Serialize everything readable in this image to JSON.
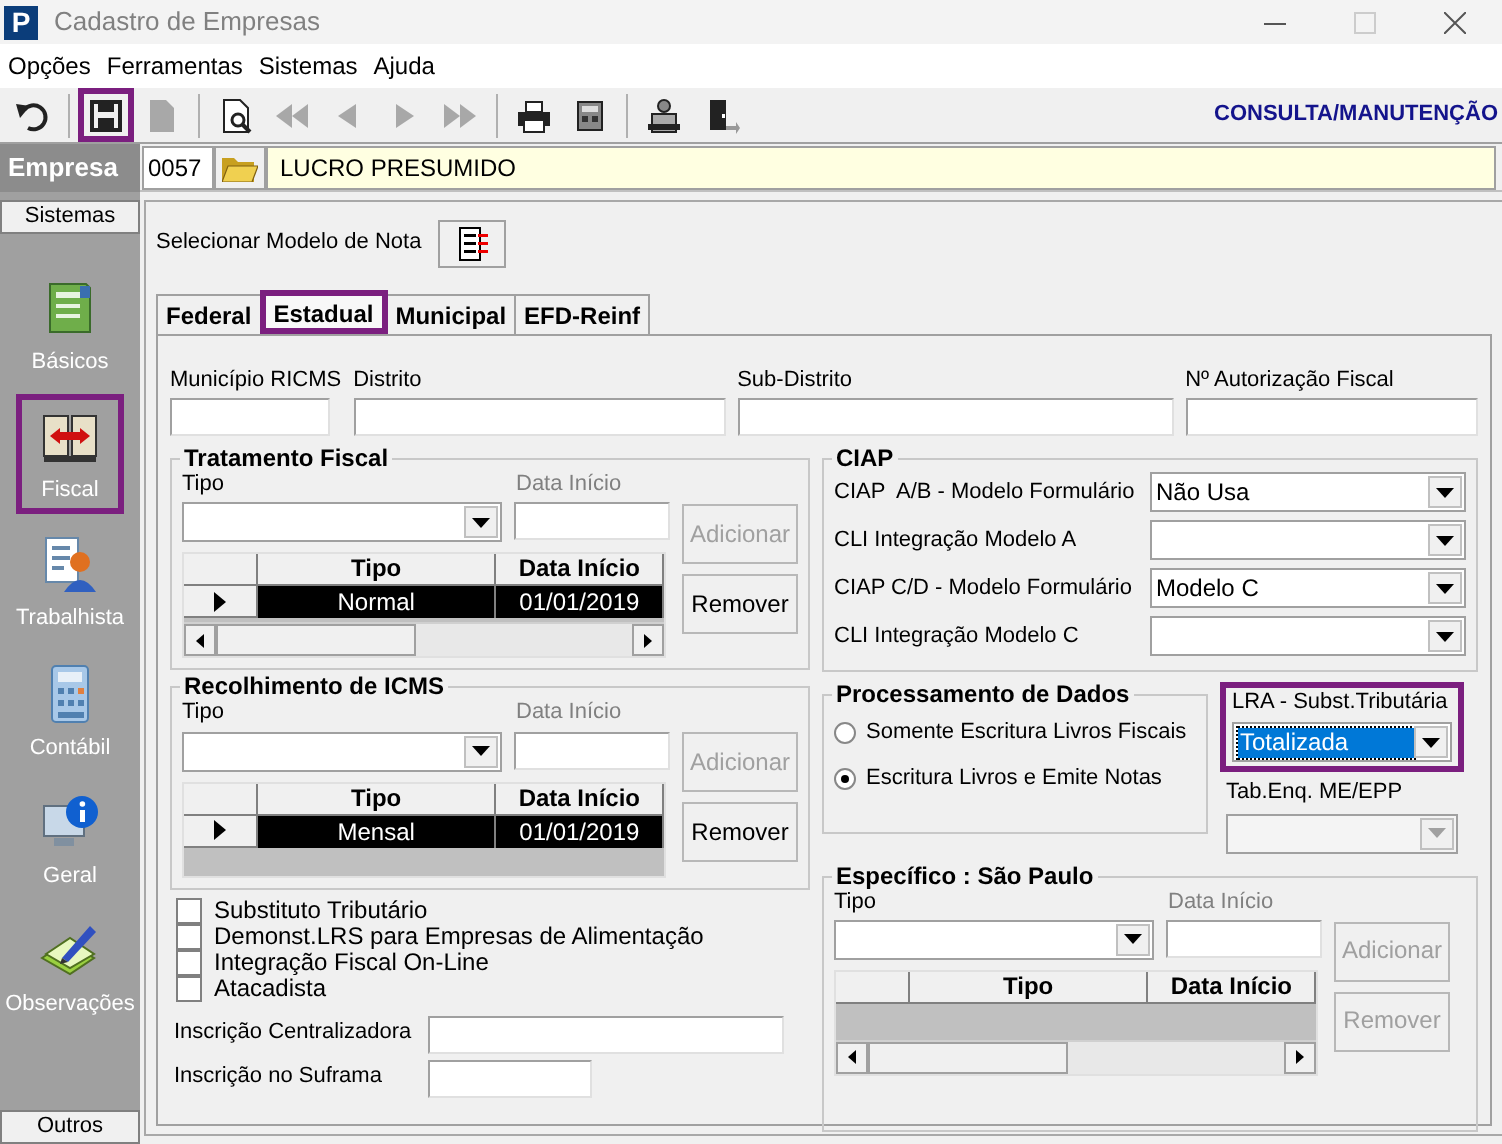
{
  "window": {
    "title": "Cadastro de Empresas",
    "app_letter": "P"
  },
  "menu": [
    "Opções",
    "Ferramentas",
    "Sistemas",
    "Ajuda"
  ],
  "toolbar": {
    "buttons": [
      {
        "disabled": false,
        "highlighted": false
      },
      {
        "disabled": false,
        "highlighted": true
      },
      {
        "disabled": true,
        "highlighted": false
      },
      {
        "disabled": false,
        "highlighted": false
      },
      {
        "disabled": true,
        "highlighted": false
      },
      {
        "disabled": true,
        "highlighted": false
      },
      {
        "disabled": true,
        "highlighted": false
      },
      {
        "disabled": true,
        "highlighted": false
      },
      {
        "disabled": false,
        "highlighted": false
      },
      {
        "disabled": false,
        "highlighted": false
      },
      {
        "disabled": false,
        "highlighted": false
      },
      {
        "disabled": false,
        "highlighted": false
      }
    ],
    "mode": "CONSULTA/MANUTENÇÃO"
  },
  "empresa": {
    "label": "Empresa",
    "code": "0057",
    "name": "LUCRO PRESUMIDO"
  },
  "sidebar": {
    "header": "Sistemas",
    "items": [
      {
        "label": "Básicos",
        "highlighted": false
      },
      {
        "label": "Fiscal",
        "highlighted": true
      },
      {
        "label": "Trabalhista",
        "highlighted": false
      },
      {
        "label": "Contábil",
        "highlighted": false
      },
      {
        "label": "Geral",
        "highlighted": false
      },
      {
        "label": "Observações",
        "highlighted": false
      }
    ],
    "footer": "Outros"
  },
  "modelo_nota": {
    "label": "Selecionar Modelo de Nota"
  },
  "tabs": [
    {
      "label": "Federal",
      "selected": false,
      "highlighted": false
    },
    {
      "label": "Estadual",
      "selected": true,
      "highlighted": true
    },
    {
      "label": "Municipal",
      "selected": false,
      "highlighted": false
    },
    {
      "label": "EFD-Reinf",
      "selected": false,
      "highlighted": false
    }
  ],
  "top_fields": [
    {
      "label": "Município RICMS"
    },
    {
      "label": "Distrito"
    },
    {
      "label": "Sub-Distrito"
    },
    {
      "label": "Nº Autorização Fiscal"
    }
  ],
  "tratamento_fiscal": {
    "title": "Tratamento Fiscal",
    "tipo_label": "Tipo",
    "date": {
      "label": "Data Início",
      "disabled": true
    },
    "grid": {
      "columns": [
        "Tipo",
        "Data Início"
      ],
      "horizontal_scroll": true,
      "rows": [
        {
          "tipo": "Normal",
          "data": "01/01/2019",
          "selected": true
        }
      ]
    },
    "buttons": [
      {
        "label": "Adicionar",
        "disabled": true
      },
      {
        "label": "Remover",
        "disabled": false
      }
    ]
  },
  "recolhimento_icms": {
    "title": "Recolhimento de ICMS",
    "tipo_label": "Tipo",
    "date": {
      "label": "Data Início",
      "disabled": true
    },
    "grid": {
      "columns": [
        "Tipo",
        "Data Início"
      ],
      "horizontal_scroll": false,
      "rows": [
        {
          "tipo": "Mensal",
          "data": "01/01/2019",
          "selected": true
        }
      ]
    },
    "buttons": [
      {
        "label": "Adicionar",
        "disabled": true
      },
      {
        "label": "Remover",
        "disabled": false
      }
    ]
  },
  "checkboxes": [
    {
      "label": "Substituto Tributário",
      "checked": false
    },
    {
      "label": "Demonst.LRS para Empresas de Alimentação",
      "checked": false
    },
    {
      "label": "Integração Fiscal On-Line",
      "checked": false
    },
    {
      "label": "Atacadista",
      "checked": false
    }
  ],
  "inscricoes": [
    {
      "label": "Inscrição Centralizadora"
    },
    {
      "label": "Inscrição no Suframa"
    }
  ],
  "ciap": {
    "title": "CIAP",
    "rows": [
      {
        "label": "CIAP  A/B - Modelo Formulário",
        "value": "Não Usa"
      },
      {
        "label": "CLI Integração Modelo A"
      },
      {
        "label": "CIAP C/D - Modelo Formulário",
        "value": "Modelo C"
      },
      {
        "label": "CLI Integração Modelo C"
      }
    ]
  },
  "processamento": {
    "title": "Processamento de Dados",
    "options": [
      {
        "label": "Somente Escritura Livros Fiscais",
        "selected": false
      },
      {
        "label": "Escritura Livros e Emite Notas",
        "selected": true
      }
    ]
  },
  "lra": {
    "label": "LRA - Subst.Tributária",
    "value": "Totalizada",
    "focused": true,
    "highlighted": true
  },
  "tab_enq": {
    "label": "Tab.Enq. ME/EPP",
    "disabled": true
  },
  "especifico": {
    "title": "Específico : São Paulo",
    "tipo_label": "Tipo",
    "date": {
      "label": "Data Início",
      "disabled": true
    },
    "grid": {
      "columns": [
        "Tipo",
        "Data Início"
      ],
      "horizontal_scroll": true
    },
    "buttons": [
      {
        "label": "Adicionar",
        "disabled": true
      },
      {
        "label": "Remover",
        "disabled": true
      }
    ]
  }
}
